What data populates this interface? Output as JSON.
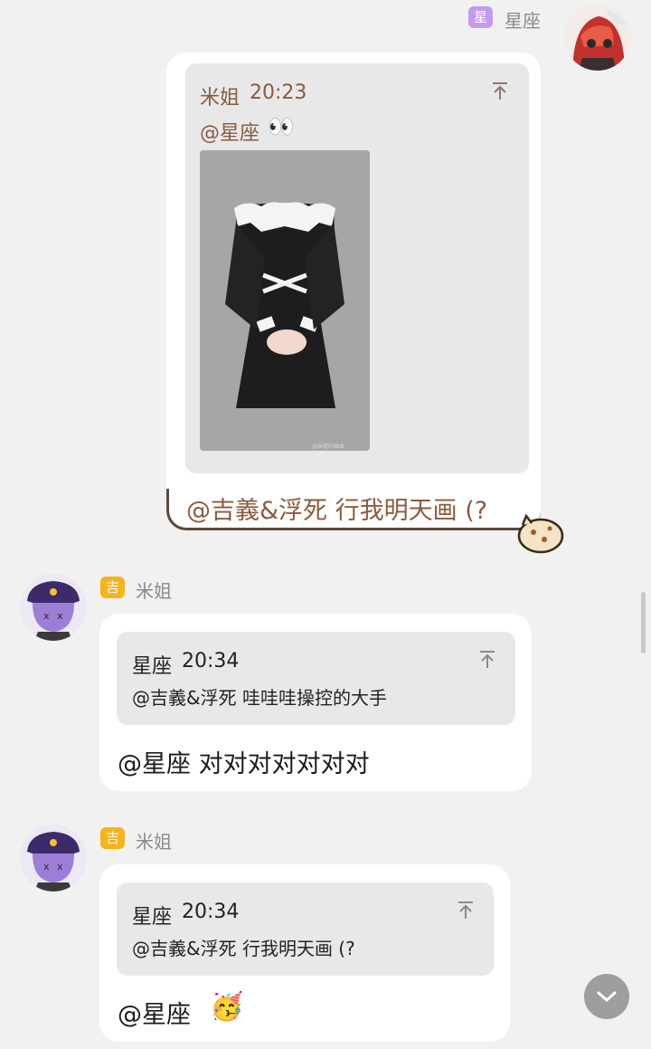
{
  "outgoing": {
    "sender": "星座",
    "badge": "星",
    "badge_color": "#c39af0",
    "quote": {
      "author": "米姐",
      "time": "20:23",
      "text": "@星座",
      "emoji": "👀"
    },
    "image_watermark": "@米姐的画本",
    "reply_text": "@吉義&浮死 行我明天画 (?"
  },
  "messages": [
    {
      "sender": "米姐",
      "badge": "吉",
      "badge_color": "#f5b41c",
      "quote": {
        "author": "星座",
        "time": "20:34",
        "text": "@吉義&浮死 哇哇哇操控的大手"
      },
      "text": "@星座 对对对对对对对"
    },
    {
      "sender": "米姐",
      "badge": "吉",
      "badge_color": "#f5b41c",
      "quote": {
        "author": "星座",
        "time": "20:34",
        "text": "@吉義&浮死 行我明天画 (?"
      },
      "text": "@星座",
      "emoji": "🥳"
    }
  ],
  "icons": {
    "pin": "pin-to-top-icon",
    "scroll": "chevron-down-icon"
  },
  "colors": {
    "background": "#f1f1f1",
    "bubble": "#ffffff",
    "quote": "#e8e8e8",
    "outgoing_quote_text": "#8c5a3c",
    "outgoing_border": "#5a4a3c"
  }
}
